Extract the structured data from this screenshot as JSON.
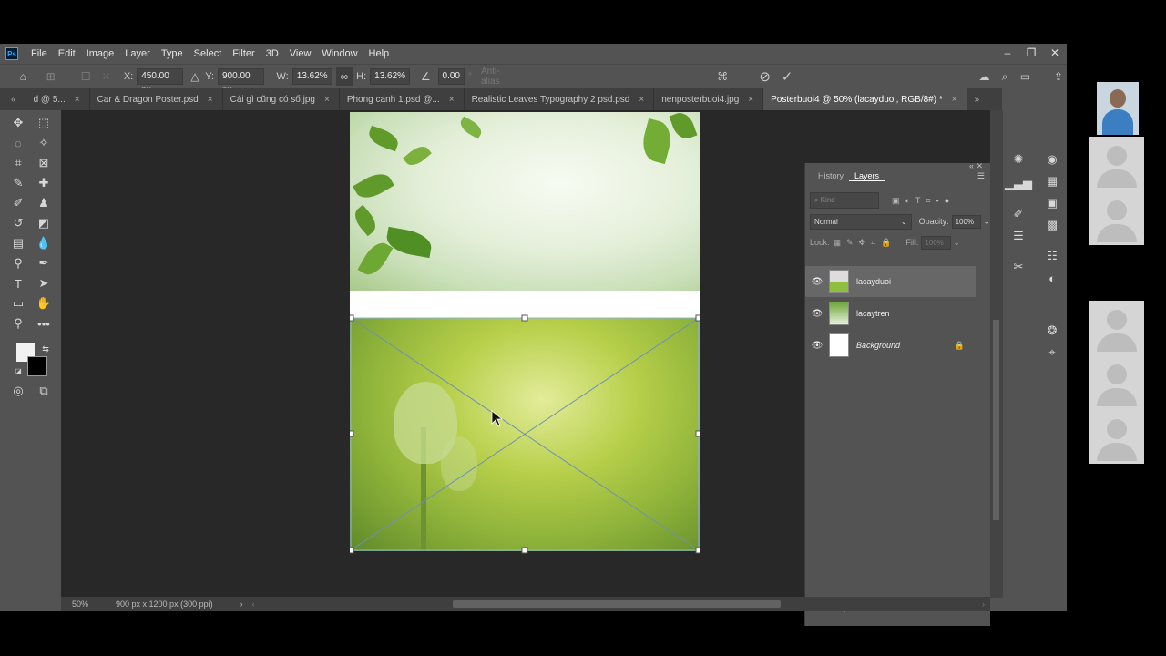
{
  "menu": [
    "File",
    "Edit",
    "Image",
    "Layer",
    "Type",
    "Select",
    "Filter",
    "3D",
    "View",
    "Window",
    "Help"
  ],
  "options": {
    "x_label": "X:",
    "x_value": "450.00 px",
    "y_label": "Y:",
    "y_value": "900.00 px",
    "w_label": "W:",
    "w_value": "13.62%",
    "h_label": "H:",
    "h_value": "13.62%",
    "angle_value": "0.00",
    "degree": "°",
    "antialias": "Anti-alias"
  },
  "tabs": [
    {
      "label": "d @ 5...",
      "close": "×"
    },
    {
      "label": "Car & Dragon Poster.psd",
      "close": "×"
    },
    {
      "label": "Cái gì cũng có số.jpg",
      "close": "×"
    },
    {
      "label": "Phong canh 1.psd @...",
      "close": "×"
    },
    {
      "label": "Realistic Leaves Typography 2 psd.psd",
      "close": "×"
    },
    {
      "label": "nenposterbuoi4.jpg",
      "close": "×"
    },
    {
      "label": "Posterbuoi4 @ 50% (lacayduoi, RGB/8#) *",
      "close": "×"
    }
  ],
  "panel": {
    "tab_history": "History",
    "tab_layers": "Layers",
    "kind_placeholder": "Kind",
    "blend_mode": "Normal",
    "opacity_label": "Opacity:",
    "opacity_value": "100%",
    "lock_label": "Lock:",
    "fill_label": "Fill:",
    "fill_value": "100%",
    "layers": [
      {
        "name": "lacayduoi",
        "selected": true
      },
      {
        "name": "lacaytren",
        "selected": false
      },
      {
        "name": "Background",
        "selected": false
      }
    ]
  },
  "status": {
    "zoom": "50%",
    "doc_info": "900 px x 1200 px (300 ppi)"
  },
  "colors": {
    "ui_bg": "#535353",
    "canvas_bg": "#282828",
    "accent": "#31a8ff"
  }
}
